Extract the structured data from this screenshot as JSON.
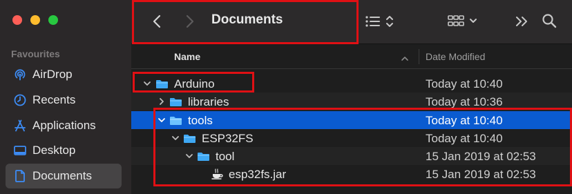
{
  "window": {
    "title": "Documents",
    "traffic_lights": {
      "close": "#fe5f57",
      "minimize": "#febc2e",
      "zoom": "#28c840"
    }
  },
  "toolbar": {
    "back_icon": "chevron-left-icon",
    "forward_icon": "chevron-right-icon",
    "list_view_icon": "list-icon",
    "group_icon": "grid-icon",
    "more_icon": "double-chevron-icon",
    "search_icon": "search-icon"
  },
  "sidebar": {
    "heading": "Favourites",
    "items": [
      {
        "label": "AirDrop",
        "icon": "airdrop-icon"
      },
      {
        "label": "Recents",
        "icon": "clock-icon"
      },
      {
        "label": "Applications",
        "icon": "applications-icon"
      },
      {
        "label": "Desktop",
        "icon": "desktop-icon"
      },
      {
        "label": "Documents",
        "icon": "document-icon",
        "active": true
      }
    ]
  },
  "columns": {
    "name": "Name",
    "date_modified": "Date Modified"
  },
  "files": [
    {
      "name": "Arduino",
      "date": "Today at 10:40",
      "kind": "folder",
      "expanded": true,
      "depth": 0
    },
    {
      "name": "libraries",
      "date": "Today at 10:36",
      "kind": "folder",
      "expanded": false,
      "depth": 1
    },
    {
      "name": "tools",
      "date": "Today at 10:40",
      "kind": "folder",
      "expanded": true,
      "depth": 1,
      "selected": true
    },
    {
      "name": "ESP32FS",
      "date": "Today at 10:40",
      "kind": "folder",
      "expanded": true,
      "depth": 2
    },
    {
      "name": "tool",
      "date": "15 Jan 2019 at 02:53",
      "kind": "folder",
      "expanded": true,
      "depth": 3
    },
    {
      "name": "esp32fs.jar",
      "date": "15 Jan 2019 at 02:53",
      "kind": "jar",
      "depth": 4
    }
  ],
  "colors": {
    "accent": "#0a5bd0",
    "folder": "#3ea8f4",
    "sidebar_icon": "#3d8cf5",
    "highlight": "#e01014"
  }
}
